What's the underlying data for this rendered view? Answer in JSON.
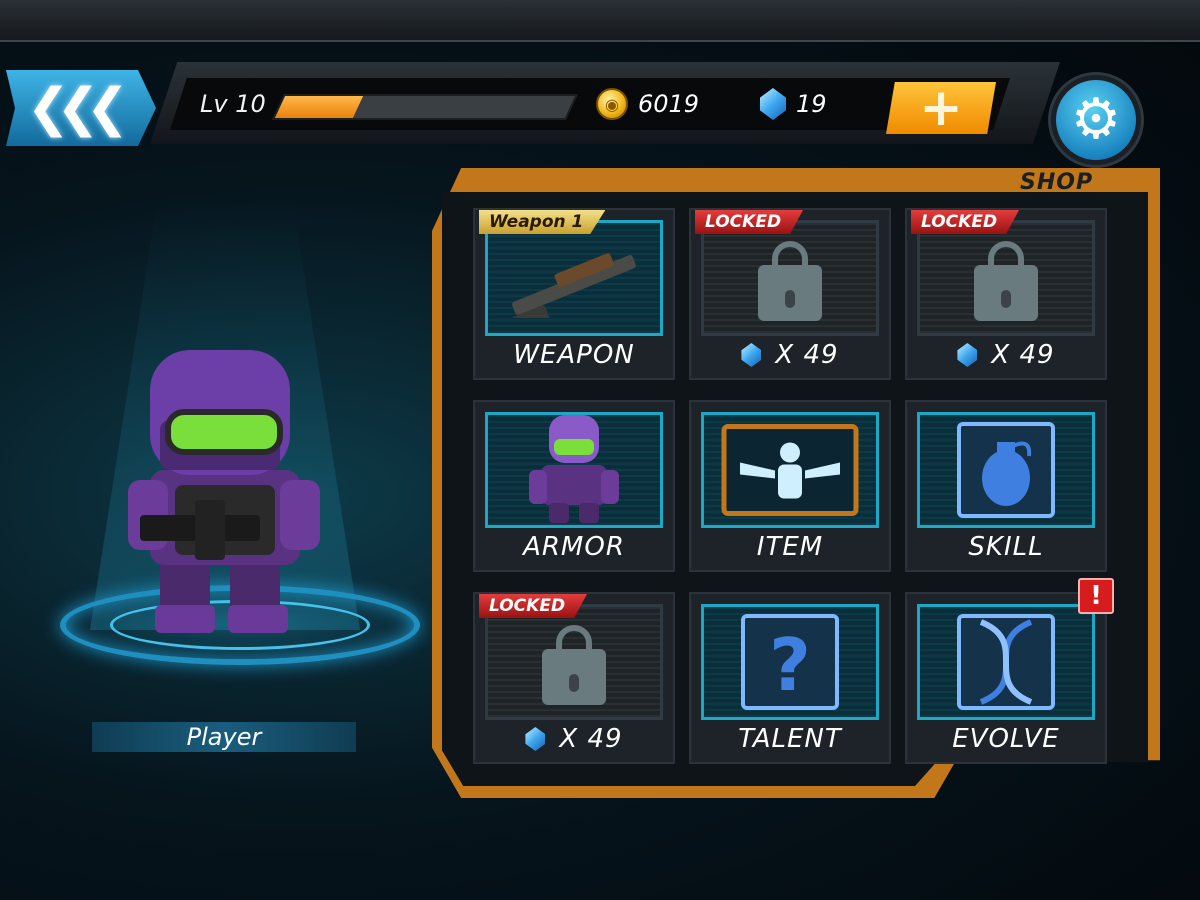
{
  "hud": {
    "level_label": "Lv 10",
    "xp_progress": 0.27,
    "coins": "6019",
    "gems": "19"
  },
  "player": {
    "name": "Player"
  },
  "shop": {
    "title": "SHOP",
    "tiles": [
      {
        "caption": "WEAPON",
        "tag": "Weapon 1",
        "locked": false
      },
      {
        "caption": "X 49",
        "tag": "LOCKED",
        "locked": true
      },
      {
        "caption": "X 49",
        "tag": "LOCKED",
        "locked": true
      },
      {
        "caption": "ARMOR",
        "locked": false
      },
      {
        "caption": "ITEM",
        "locked": false
      },
      {
        "caption": "SKILL",
        "locked": false
      },
      {
        "caption": "X 49",
        "tag": "LOCKED",
        "locked": true
      },
      {
        "caption": "TALENT",
        "locked": false
      },
      {
        "caption": "EVOLVE",
        "locked": false,
        "alert": "!"
      }
    ]
  },
  "colors": {
    "accent_blue": "#1ea8c8",
    "frame_orange": "#c2781a",
    "xp_orange": "#f09a1a",
    "locked_red": "#c41e1e"
  }
}
